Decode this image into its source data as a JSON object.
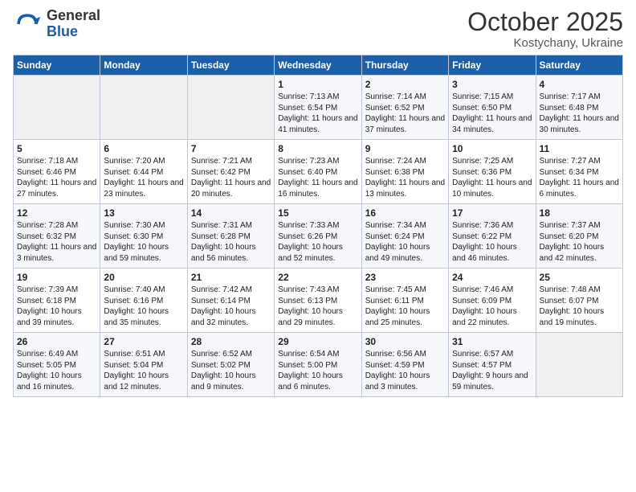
{
  "header": {
    "logo_general": "General",
    "logo_blue": "Blue",
    "title": "October 2025",
    "subtitle": "Kostychany, Ukraine"
  },
  "days_of_week": [
    "Sunday",
    "Monday",
    "Tuesday",
    "Wednesday",
    "Thursday",
    "Friday",
    "Saturday"
  ],
  "weeks": [
    [
      {
        "day": "",
        "sunrise": "",
        "sunset": "",
        "daylight": "",
        "empty": true
      },
      {
        "day": "",
        "sunrise": "",
        "sunset": "",
        "daylight": "",
        "empty": true
      },
      {
        "day": "",
        "sunrise": "",
        "sunset": "",
        "daylight": "",
        "empty": true
      },
      {
        "day": "1",
        "sunrise": "Sunrise: 7:13 AM",
        "sunset": "Sunset: 6:54 PM",
        "daylight": "Daylight: 11 hours and 41 minutes."
      },
      {
        "day": "2",
        "sunrise": "Sunrise: 7:14 AM",
        "sunset": "Sunset: 6:52 PM",
        "daylight": "Daylight: 11 hours and 37 minutes."
      },
      {
        "day": "3",
        "sunrise": "Sunrise: 7:15 AM",
        "sunset": "Sunset: 6:50 PM",
        "daylight": "Daylight: 11 hours and 34 minutes."
      },
      {
        "day": "4",
        "sunrise": "Sunrise: 7:17 AM",
        "sunset": "Sunset: 6:48 PM",
        "daylight": "Daylight: 11 hours and 30 minutes."
      }
    ],
    [
      {
        "day": "5",
        "sunrise": "Sunrise: 7:18 AM",
        "sunset": "Sunset: 6:46 PM",
        "daylight": "Daylight: 11 hours and 27 minutes."
      },
      {
        "day": "6",
        "sunrise": "Sunrise: 7:20 AM",
        "sunset": "Sunset: 6:44 PM",
        "daylight": "Daylight: 11 hours and 23 minutes."
      },
      {
        "day": "7",
        "sunrise": "Sunrise: 7:21 AM",
        "sunset": "Sunset: 6:42 PM",
        "daylight": "Daylight: 11 hours and 20 minutes."
      },
      {
        "day": "8",
        "sunrise": "Sunrise: 7:23 AM",
        "sunset": "Sunset: 6:40 PM",
        "daylight": "Daylight: 11 hours and 16 minutes."
      },
      {
        "day": "9",
        "sunrise": "Sunrise: 7:24 AM",
        "sunset": "Sunset: 6:38 PM",
        "daylight": "Daylight: 11 hours and 13 minutes."
      },
      {
        "day": "10",
        "sunrise": "Sunrise: 7:25 AM",
        "sunset": "Sunset: 6:36 PM",
        "daylight": "Daylight: 11 hours and 10 minutes."
      },
      {
        "day": "11",
        "sunrise": "Sunrise: 7:27 AM",
        "sunset": "Sunset: 6:34 PM",
        "daylight": "Daylight: 11 hours and 6 minutes."
      }
    ],
    [
      {
        "day": "12",
        "sunrise": "Sunrise: 7:28 AM",
        "sunset": "Sunset: 6:32 PM",
        "daylight": "Daylight: 11 hours and 3 minutes."
      },
      {
        "day": "13",
        "sunrise": "Sunrise: 7:30 AM",
        "sunset": "Sunset: 6:30 PM",
        "daylight": "Daylight: 10 hours and 59 minutes."
      },
      {
        "day": "14",
        "sunrise": "Sunrise: 7:31 AM",
        "sunset": "Sunset: 6:28 PM",
        "daylight": "Daylight: 10 hours and 56 minutes."
      },
      {
        "day": "15",
        "sunrise": "Sunrise: 7:33 AM",
        "sunset": "Sunset: 6:26 PM",
        "daylight": "Daylight: 10 hours and 52 minutes."
      },
      {
        "day": "16",
        "sunrise": "Sunrise: 7:34 AM",
        "sunset": "Sunset: 6:24 PM",
        "daylight": "Daylight: 10 hours and 49 minutes."
      },
      {
        "day": "17",
        "sunrise": "Sunrise: 7:36 AM",
        "sunset": "Sunset: 6:22 PM",
        "daylight": "Daylight: 10 hours and 46 minutes."
      },
      {
        "day": "18",
        "sunrise": "Sunrise: 7:37 AM",
        "sunset": "Sunset: 6:20 PM",
        "daylight": "Daylight: 10 hours and 42 minutes."
      }
    ],
    [
      {
        "day": "19",
        "sunrise": "Sunrise: 7:39 AM",
        "sunset": "Sunset: 6:18 PM",
        "daylight": "Daylight: 10 hours and 39 minutes."
      },
      {
        "day": "20",
        "sunrise": "Sunrise: 7:40 AM",
        "sunset": "Sunset: 6:16 PM",
        "daylight": "Daylight: 10 hours and 35 minutes."
      },
      {
        "day": "21",
        "sunrise": "Sunrise: 7:42 AM",
        "sunset": "Sunset: 6:14 PM",
        "daylight": "Daylight: 10 hours and 32 minutes."
      },
      {
        "day": "22",
        "sunrise": "Sunrise: 7:43 AM",
        "sunset": "Sunset: 6:13 PM",
        "daylight": "Daylight: 10 hours and 29 minutes."
      },
      {
        "day": "23",
        "sunrise": "Sunrise: 7:45 AM",
        "sunset": "Sunset: 6:11 PM",
        "daylight": "Daylight: 10 hours and 25 minutes."
      },
      {
        "day": "24",
        "sunrise": "Sunrise: 7:46 AM",
        "sunset": "Sunset: 6:09 PM",
        "daylight": "Daylight: 10 hours and 22 minutes."
      },
      {
        "day": "25",
        "sunrise": "Sunrise: 7:48 AM",
        "sunset": "Sunset: 6:07 PM",
        "daylight": "Daylight: 10 hours and 19 minutes."
      }
    ],
    [
      {
        "day": "26",
        "sunrise": "Sunrise: 6:49 AM",
        "sunset": "Sunset: 5:05 PM",
        "daylight": "Daylight: 10 hours and 16 minutes."
      },
      {
        "day": "27",
        "sunrise": "Sunrise: 6:51 AM",
        "sunset": "Sunset: 5:04 PM",
        "daylight": "Daylight: 10 hours and 12 minutes."
      },
      {
        "day": "28",
        "sunrise": "Sunrise: 6:52 AM",
        "sunset": "Sunset: 5:02 PM",
        "daylight": "Daylight: 10 hours and 9 minutes."
      },
      {
        "day": "29",
        "sunrise": "Sunrise: 6:54 AM",
        "sunset": "Sunset: 5:00 PM",
        "daylight": "Daylight: 10 hours and 6 minutes."
      },
      {
        "day": "30",
        "sunrise": "Sunrise: 6:56 AM",
        "sunset": "Sunset: 4:59 PM",
        "daylight": "Daylight: 10 hours and 3 minutes."
      },
      {
        "day": "31",
        "sunrise": "Sunrise: 6:57 AM",
        "sunset": "Sunset: 4:57 PM",
        "daylight": "Daylight: 9 hours and 59 minutes."
      },
      {
        "day": "",
        "sunrise": "",
        "sunset": "",
        "daylight": "",
        "empty": true
      }
    ]
  ]
}
